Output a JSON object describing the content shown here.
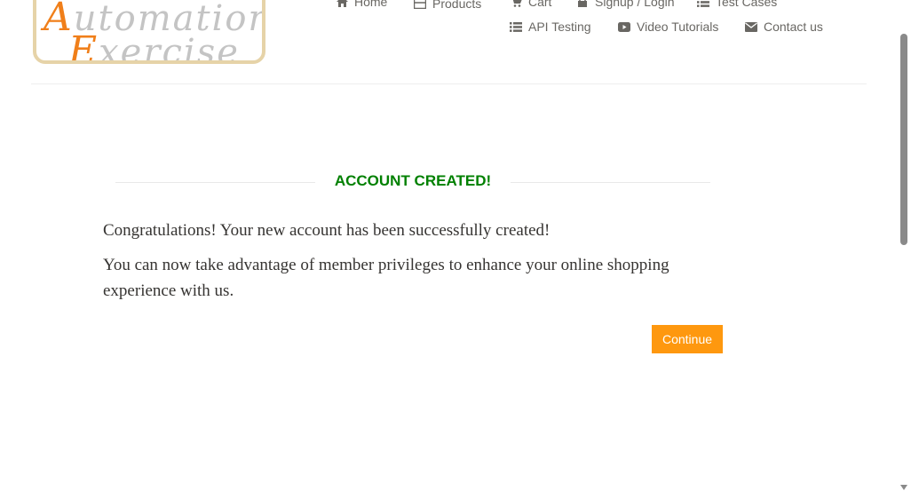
{
  "logo": {
    "line1_cap": "A",
    "line1_rest": "utomation",
    "line2_cap": "E",
    "line2_rest": "xercise"
  },
  "nav": {
    "items": [
      {
        "label": "Home",
        "icon": "home-icon"
      },
      {
        "label": "Products",
        "icon": "products-icon"
      },
      {
        "label": "Cart",
        "icon": "cart-icon"
      },
      {
        "label": "Signup / Login",
        "icon": "lock-icon"
      },
      {
        "label": "Test Cases",
        "icon": "list-icon"
      },
      {
        "label": "API Testing",
        "icon": "list-icon"
      },
      {
        "label": "Video Tutorials",
        "icon": "youtube-play-icon"
      },
      {
        "label": "Contact us",
        "icon": "envelope-icon"
      }
    ]
  },
  "main": {
    "title": "ACCOUNT CREATED!",
    "message1": "Congratulations! Your new account has been successfully created!",
    "message2": "You can now take advantage of member privileges to enhance your online shopping experience with us.",
    "continue_label": "Continue"
  },
  "colors": {
    "accent": "#fe980f",
    "title_green": "#008000",
    "nav_text": "#696763",
    "logo_orange": "#f07f1a"
  }
}
